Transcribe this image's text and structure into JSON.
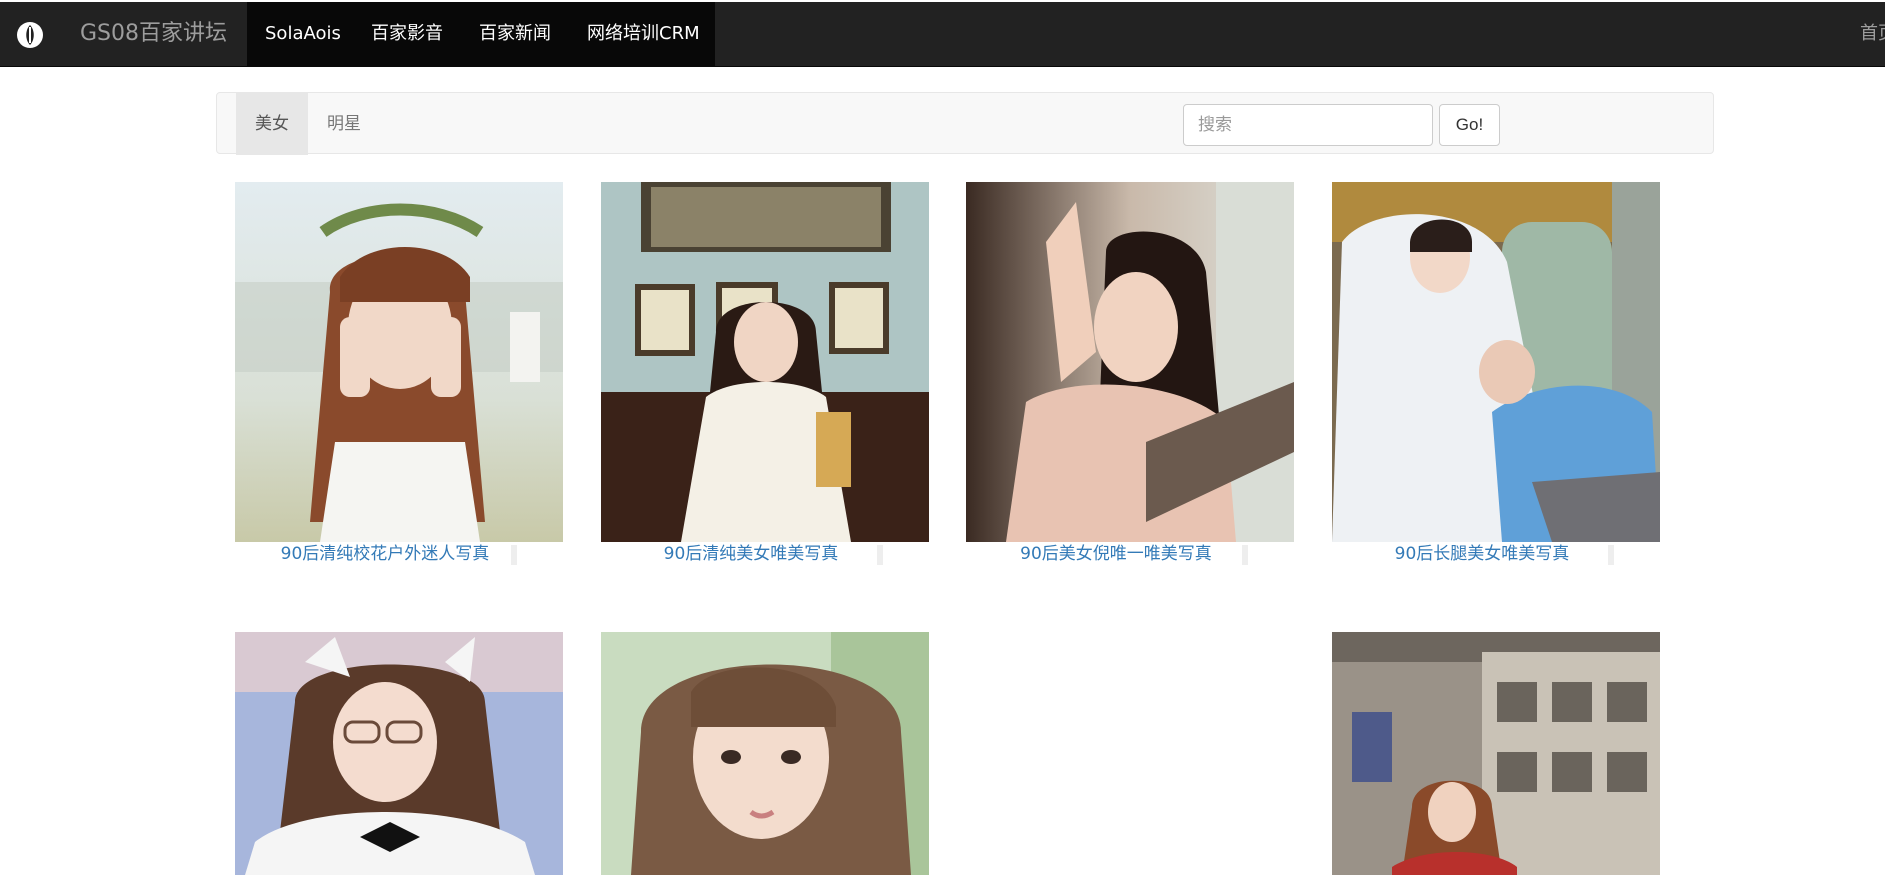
{
  "navbar": {
    "logo_icon": "brand-logo-icon",
    "brand": "GS08百家讲坛",
    "items": [
      {
        "label": "SolaAois"
      },
      {
        "label": "百家影音"
      },
      {
        "label": "百家新闻"
      },
      {
        "label": "网络培训CRM"
      }
    ],
    "right_link": "首页"
  },
  "subnav": {
    "tabs": [
      {
        "label": "美女",
        "active": true
      },
      {
        "label": "明星",
        "active": false
      }
    ],
    "search": {
      "placeholder": "搜索",
      "value": ""
    },
    "go_label": "Go!"
  },
  "gallery": [
    {
      "caption": "90后清纯校花户外迷人写真"
    },
    {
      "caption": "90后清纯美女唯美写真"
    },
    {
      "caption": "90后美女倪唯一唯美写真"
    },
    {
      "caption": "90后长腿美女唯美写真"
    },
    {
      "caption": ""
    },
    {
      "caption": ""
    },
    {
      "caption": ""
    },
    {
      "caption": ""
    }
  ],
  "colors": {
    "navbar_bg": "#222222",
    "navbar_active_bg": "#080808",
    "link": "#337ab7",
    "subnav_bg": "#f8f8f8"
  }
}
